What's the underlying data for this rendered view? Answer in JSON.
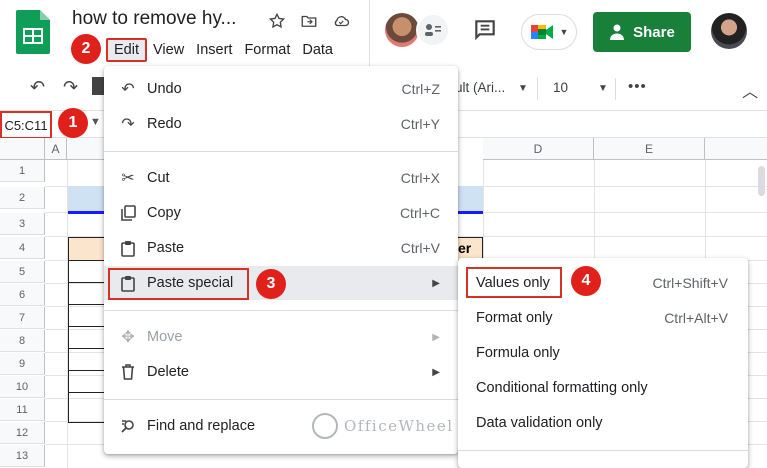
{
  "title_bar": {
    "doc_title": "how to remove hy...",
    "menu": [
      "Edit",
      "View",
      "Insert",
      "Format",
      "Data"
    ],
    "share_label": "Share",
    "icons": [
      "sheets-logo",
      "star-icon",
      "move-to-folder-icon",
      "cloud-saved-icon",
      "comment-icon",
      "meet-icon"
    ]
  },
  "toolbar": {
    "font": "ult (Ari...",
    "font_size": "10"
  },
  "formula_bar": {
    "name_box": "C5:C11"
  },
  "grid": {
    "columns": [
      "A",
      "D",
      "E"
    ],
    "rows": [
      "1",
      "2",
      "3",
      "4",
      "5",
      "6",
      "7",
      "8",
      "9",
      "10",
      "11",
      "12",
      "13"
    ],
    "header_text": "er",
    "colors": {
      "band": "#cfe2f3",
      "band_line": "#1a1aff",
      "header": "#fce5cd"
    }
  },
  "edit_menu": {
    "items": [
      {
        "label": "Undo",
        "shortcut": "Ctrl+Z",
        "icon": "undo-icon"
      },
      {
        "label": "Redo",
        "shortcut": "Ctrl+Y",
        "icon": "redo-icon"
      },
      {
        "label": "Cut",
        "shortcut": "Ctrl+X",
        "icon": "cut-icon"
      },
      {
        "label": "Copy",
        "shortcut": "Ctrl+C",
        "icon": "copy-icon"
      },
      {
        "label": "Paste",
        "shortcut": "Ctrl+V",
        "icon": "paste-icon"
      },
      {
        "label": "Paste special",
        "icon": "paste-special-icon"
      },
      {
        "label": "Move",
        "icon": "move-icon"
      },
      {
        "label": "Delete",
        "icon": "delete-icon"
      },
      {
        "label": "Find and replace",
        "icon": "find-replace-icon"
      }
    ]
  },
  "paste_special_menu": {
    "items": [
      {
        "label": "Values only",
        "shortcut": "Ctrl+Shift+V"
      },
      {
        "label": "Format only",
        "shortcut": "Ctrl+Alt+V"
      },
      {
        "label": "Formula only"
      },
      {
        "label": "Conditional formatting only"
      },
      {
        "label": "Data validation only"
      }
    ]
  },
  "callouts": [
    "1",
    "2",
    "3",
    "4"
  ],
  "watermark": "OfficeWheel",
  "accent_colors": {
    "share": "#188038",
    "callout": "#e0201b"
  }
}
